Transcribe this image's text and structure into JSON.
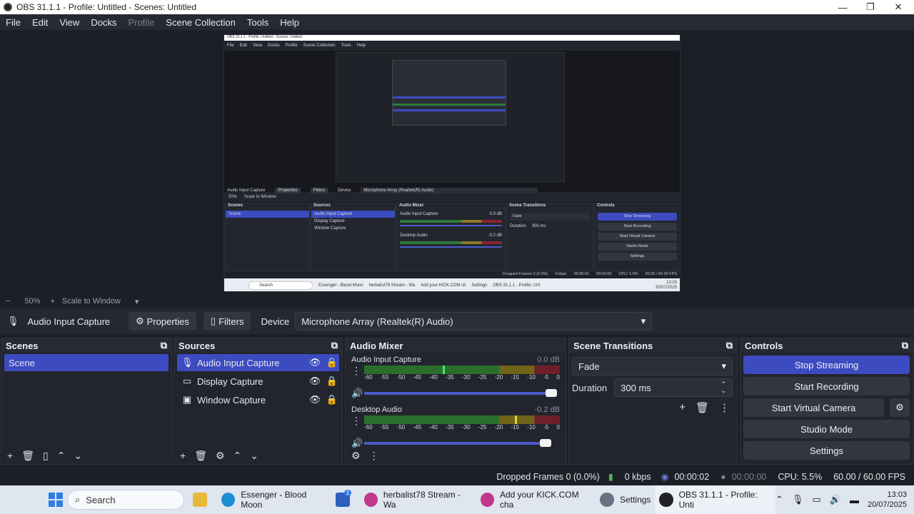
{
  "window": {
    "title": "OBS 31.1.1 - Profile: Untitled - Scenes: Untitled",
    "minimize": "—",
    "maximize": "❐",
    "close": "✕"
  },
  "menu": [
    "File",
    "Edit",
    "View",
    "Docks",
    "Profile",
    "Scene Collection",
    "Tools",
    "Help"
  ],
  "preview": {
    "nested_title": "OBS 31.1.1 - Profile: Untitled - Scenes: Untitled",
    "nested_menu": [
      "File",
      "Edit",
      "View",
      "Docks",
      "Profile",
      "Scene Collection",
      "Tools",
      "Help"
    ],
    "toolbar": [
      "50%",
      "Scale to Window"
    ],
    "source": "Audio Input Capture",
    "properties": "Properties",
    "filters": "Filters",
    "device_label": "Device",
    "device_value": "Microphone Array (Realtek(R) Audio)",
    "scenes_title": "Scenes",
    "scene": "Scene",
    "sources_title": "Sources",
    "sources": [
      "Audio Input Capture",
      "Display Capture",
      "Window Capture"
    ],
    "mixer_title": "Audio Mixer",
    "ch1": "Audio Input Capture",
    "ch1_db": "0.0 dB",
    "ch2": "Desktop Audio",
    "ch2_db": "-0.2 dB",
    "transitions_title": "Scene Transitions",
    "fade": "Fade",
    "duration": "Duration",
    "duration_value": "300 ms",
    "controls_title": "Controls",
    "controls": [
      "Stop Streaming",
      "Start Recording",
      "Start Virtual Camera",
      "Studio Mode",
      "Settings"
    ],
    "status": [
      "Dropped Frames 0 (0.0%)",
      "0 kbps",
      "00:00:01",
      "00:00:00",
      "CPU: 5.5%",
      "60.00 / 60.00 FPS"
    ],
    "taskbar_search": "Search",
    "taskbar_items": [
      "Essenger - Blood Moon",
      "herbalist78 Stream - Wa",
      "Add your KICK.COM ch",
      "Settings",
      "OBS 31.1.1 - Profile: Unt"
    ],
    "clock_time": "13:03",
    "clock_date": "20/07/2025"
  },
  "zoom": {
    "minus": "−",
    "value": "50%",
    "plus": "+",
    "scale": "Scale to Window",
    "caret": "▾"
  },
  "source_toolbar": {
    "name": "Audio Input Capture",
    "properties": "Properties",
    "filters": "Filters",
    "device_label": "Device",
    "device_value": "Microphone Array (Realtek(R) Audio)"
  },
  "scenes": {
    "title": "Scenes",
    "items": [
      "Scene"
    ]
  },
  "sources": {
    "title": "Sources",
    "items": [
      "Audio Input Capture",
      "Display Capture",
      "Window Capture"
    ]
  },
  "mixer": {
    "title": "Audio Mixer",
    "channels": [
      {
        "name": "Audio Input Capture",
        "db": "0.0 dB",
        "level": 0.4
      },
      {
        "name": "Desktop Audio",
        "db": "-0.2 dB",
        "level": 0.77
      }
    ],
    "ticks": [
      "-60",
      "-55",
      "-50",
      "-45",
      "-40",
      "-35",
      "-30",
      "-25",
      "-20",
      "-15",
      "-10",
      "-5",
      "0"
    ]
  },
  "transitions": {
    "title": "Scene Transitions",
    "type": "Fade",
    "duration_label": "Duration",
    "duration_value": "300 ms"
  },
  "controls": {
    "title": "Controls",
    "stop_streaming": "Stop Streaming",
    "start_recording": "Start Recording",
    "start_virtual_camera": "Start Virtual Camera",
    "studio_mode": "Studio Mode",
    "settings": "Settings"
  },
  "status": {
    "dropped": "Dropped Frames 0 (0.0%)",
    "kbps": "0 kbps",
    "stream_time": "00:00:02",
    "record_time": "00:00:00",
    "cpu": "CPU: 5.5%",
    "fps": "60.00 / 60.00 FPS"
  },
  "taskbar": {
    "search": "Search",
    "items": [
      "Essenger - Blood Moon",
      "herbalist78 Stream - Wa",
      "Add your KICK.COM cha",
      "Settings",
      "OBS 31.1.1 - Profile: Unti"
    ],
    "badge": "1",
    "time": "13:03",
    "date": "20/07/2025"
  },
  "colors": {
    "accent": "#3c4bbf",
    "meter_green": "#2b6e2c",
    "meter_yellow": "#6f6418",
    "meter_red": "#6e1f2a"
  }
}
